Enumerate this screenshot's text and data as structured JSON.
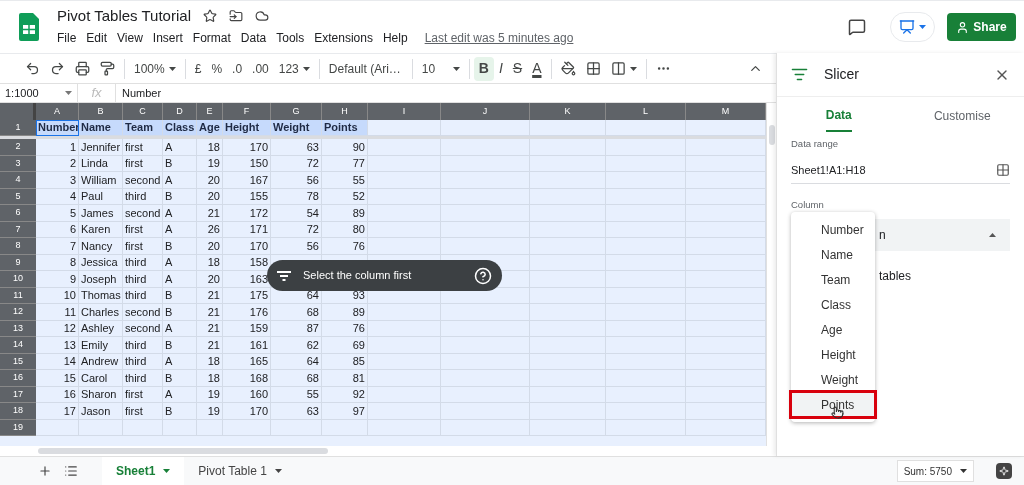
{
  "document": {
    "title": "Pivot Tables Tutorial",
    "last_edit": "Last edit was 5 minutes ago"
  },
  "menu": [
    "File",
    "Edit",
    "View",
    "Insert",
    "Format",
    "Data",
    "Tools",
    "Extensions",
    "Help"
  ],
  "share_button": "Share",
  "toolbar": {
    "zoom": "100%",
    "currency": "£",
    "percent": "%",
    "decrease_decimal": ".0",
    "increase_decimal": ".00",
    "number_format": "123",
    "font": "Default (Ari…",
    "font_size": "10",
    "bold": {
      "label": "B",
      "selected": true
    },
    "italic": "I",
    "strikethrough": "S",
    "text_color": "A"
  },
  "formula_bar": {
    "name_box": "1:1000",
    "fx": "fx",
    "value": "Number"
  },
  "grid": {
    "columns": [
      "A",
      "B",
      "C",
      "D",
      "E",
      "F",
      "G",
      "H",
      "I",
      "J",
      "K",
      "L",
      "M"
    ],
    "rows": [
      {
        "number": "1",
        "kind": "header",
        "cells": [
          "Number",
          "Name",
          "Team",
          "Class",
          "Age",
          "Height",
          "Weight",
          "Points"
        ]
      },
      {
        "number": "2",
        "kind": "data",
        "cells": [
          "1",
          "Jennifer",
          "first",
          "A",
          "18",
          "170",
          "63",
          "90"
        ]
      },
      {
        "number": "3",
        "kind": "data",
        "cells": [
          "2",
          "Linda",
          "first",
          "B",
          "19",
          "150",
          "72",
          "77"
        ]
      },
      {
        "number": "4",
        "kind": "data",
        "cells": [
          "3",
          "William",
          "second",
          "A",
          "20",
          "167",
          "56",
          "55"
        ]
      },
      {
        "number": "5",
        "kind": "data",
        "cells": [
          "4",
          "Paul",
          "third",
          "B",
          "20",
          "155",
          "78",
          "52"
        ]
      },
      {
        "number": "6",
        "kind": "data",
        "cells": [
          "5",
          "James",
          "second",
          "A",
          "21",
          "172",
          "54",
          "89"
        ]
      },
      {
        "number": "7",
        "kind": "data",
        "cells": [
          "6",
          "Karen",
          "first",
          "A",
          "26",
          "171",
          "72",
          "80"
        ]
      },
      {
        "number": "8",
        "kind": "data",
        "cells": [
          "7",
          "Nancy",
          "first",
          "B",
          "20",
          "170",
          "56",
          "76"
        ]
      },
      {
        "number": "9",
        "kind": "data",
        "cells": [
          "8",
          "Jessica",
          "third",
          "A",
          "18",
          "158",
          null,
          null
        ]
      },
      {
        "number": "10",
        "kind": "data",
        "cells": [
          "9",
          "Joseph",
          "third",
          "A",
          "20",
          "163",
          null,
          null,
          null
        ]
      },
      {
        "number": "11",
        "kind": "data",
        "cells": [
          "10",
          "Thomas",
          "third",
          "B",
          "21",
          "175",
          "64",
          "93"
        ]
      },
      {
        "number": "12",
        "kind": "data",
        "cells": [
          "11",
          "Charles",
          "second",
          "B",
          "21",
          "176",
          "68",
          "89"
        ]
      },
      {
        "number": "13",
        "kind": "data",
        "cells": [
          "12",
          "Ashley",
          "second",
          "A",
          "21",
          "159",
          "87",
          "76"
        ]
      },
      {
        "number": "14",
        "kind": "data",
        "cells": [
          "13",
          "Emily",
          "third",
          "B",
          "21",
          "161",
          "62",
          "69"
        ]
      },
      {
        "number": "15",
        "kind": "data",
        "cells": [
          "14",
          "Andrew",
          "third",
          "A",
          "18",
          "165",
          "64",
          "85"
        ]
      },
      {
        "number": "16",
        "kind": "data",
        "cells": [
          "15",
          "Carol",
          "third",
          "B",
          "18",
          "168",
          "68",
          "81"
        ]
      },
      {
        "number": "17",
        "kind": "data",
        "cells": [
          "16",
          "Sharon",
          "first",
          "A",
          "19",
          "160",
          "55",
          "92"
        ]
      },
      {
        "number": "18",
        "kind": "data",
        "cells": [
          "17",
          "Jason",
          "first",
          "B",
          "19",
          "170",
          "63",
          "97"
        ]
      },
      {
        "number": "19",
        "kind": "data",
        "cells": []
      }
    ]
  },
  "toast": {
    "text": "Select the column first"
  },
  "slicer": {
    "title": "Slicer",
    "tabs": [
      {
        "label": "Data",
        "selected": true
      },
      {
        "label": "Customise",
        "selected": false
      }
    ],
    "data_range_label": "Data range",
    "data_range": "Sheet1!A1:H18",
    "column_label": "Column",
    "column_field_visible": "n",
    "option_visible": "tables",
    "column_menu": [
      {
        "label": "Number",
        "selected": false
      },
      {
        "label": "Name",
        "selected": false
      },
      {
        "label": "Team",
        "selected": false
      },
      {
        "label": "Class",
        "selected": false
      },
      {
        "label": "Age",
        "selected": false
      },
      {
        "label": "Height",
        "selected": false
      },
      {
        "label": "Weight",
        "selected": false
      },
      {
        "label": "Points",
        "selected": true
      }
    ]
  },
  "sheet_tabs": [
    {
      "label": "Sheet1",
      "selected": true
    },
    {
      "label": "Pivot Table 1",
      "selected": false
    }
  ],
  "sum": "Sum: 5750"
}
